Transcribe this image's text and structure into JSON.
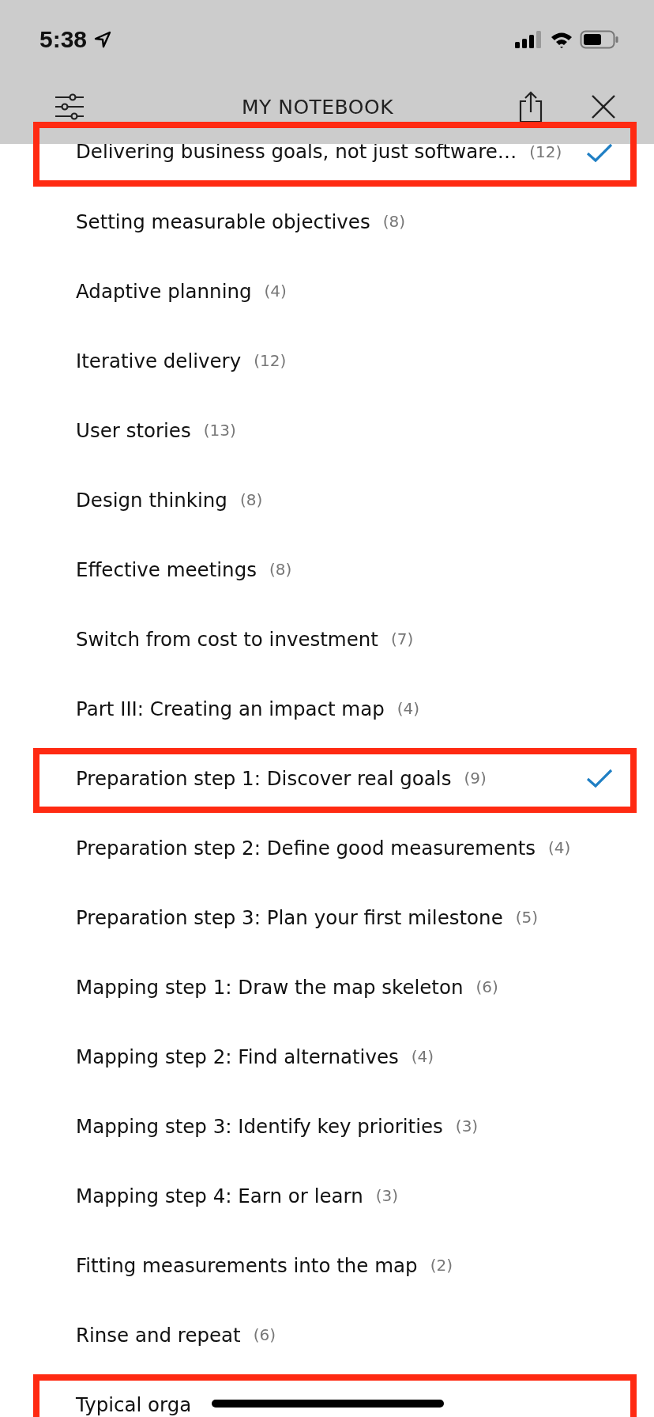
{
  "status_bar": {
    "time": "5:38"
  },
  "header": {
    "title": "MY NOTEBOOK"
  },
  "items": [
    {
      "label": "Delivering business goals, not just software…",
      "count": "(12)",
      "checked": true,
      "highlighted": true
    },
    {
      "label": "Setting measurable objectives",
      "count": "(8)",
      "checked": false,
      "highlighted": false
    },
    {
      "label": "Adaptive planning",
      "count": "(4)",
      "checked": false,
      "highlighted": false
    },
    {
      "label": "Iterative delivery",
      "count": "(12)",
      "checked": false,
      "highlighted": false
    },
    {
      "label": "User stories",
      "count": "(13)",
      "checked": false,
      "highlighted": false
    },
    {
      "label": "Design thinking",
      "count": "(8)",
      "checked": false,
      "highlighted": false
    },
    {
      "label": "Effective meetings",
      "count": "(8)",
      "checked": false,
      "highlighted": false
    },
    {
      "label": "Switch from cost to investment",
      "count": "(7)",
      "checked": false,
      "highlighted": false
    },
    {
      "label": "Part III: Creating an impact map",
      "count": "(4)",
      "checked": false,
      "highlighted": false
    },
    {
      "label": "Preparation step 1: Discover real goals",
      "count": "(9)",
      "checked": true,
      "highlighted": true
    },
    {
      "label": "Preparation step 2: Define good measurements",
      "count": "(4)",
      "checked": false,
      "highlighted": false
    },
    {
      "label": "Preparation step 3: Plan your first milestone",
      "count": "(5)",
      "checked": false,
      "highlighted": false
    },
    {
      "label": "Mapping step 1: Draw the map skeleton",
      "count": "(6)",
      "checked": false,
      "highlighted": false
    },
    {
      "label": "Mapping step 2: Find alternatives",
      "count": "(4)",
      "checked": false,
      "highlighted": false
    },
    {
      "label": "Mapping step 3: Identify key priorities",
      "count": "(3)",
      "checked": false,
      "highlighted": false
    },
    {
      "label": "Mapping step 4: Earn or learn",
      "count": "(3)",
      "checked": false,
      "highlighted": false
    },
    {
      "label": "Fitting measurements into the map",
      "count": "(2)",
      "checked": false,
      "highlighted": false
    },
    {
      "label": "Rinse and repeat",
      "count": "(6)",
      "checked": false,
      "highlighted": false
    },
    {
      "label": "Typical orga",
      "checked": false,
      "highlighted": true
    }
  ]
}
